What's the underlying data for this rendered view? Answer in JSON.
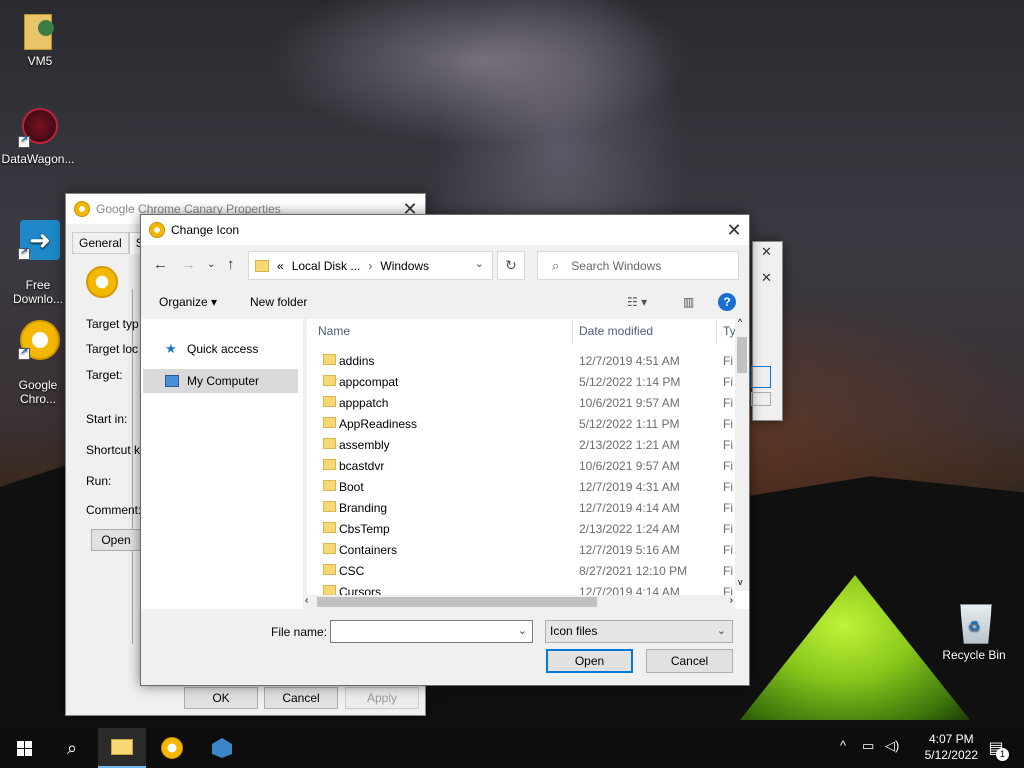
{
  "desktop": {
    "icons": [
      {
        "label": "VM5"
      },
      {
        "label": "DataWagon..."
      },
      {
        "label": "Free\nDownlo..."
      },
      {
        "label": "Google\nChro..."
      },
      {
        "label": "Recycle Bin"
      }
    ]
  },
  "properties_window": {
    "title": "Google Chrome Canary Properties",
    "tabs": [
      "General",
      "Sh"
    ],
    "labels": [
      "Target typ",
      "Target loc",
      "Target:",
      "Start in:",
      "Shortcut k",
      "Run:",
      "Comment:"
    ],
    "open_button": "Open",
    "ok": "OK",
    "cancel": "Cancel",
    "apply": "Apply"
  },
  "dialog": {
    "title": "Change Icon",
    "close_symbol": "✕",
    "address": {
      "overflow": "«",
      "crumbs": [
        "Local Disk ...",
        "Windows"
      ]
    },
    "search_placeholder": "Search Windows",
    "toolbar": {
      "organize": "Organize",
      "new_folder": "New folder",
      "help": "?"
    },
    "nav": {
      "quick_access": "Quick access",
      "my_computer": "My Computer"
    },
    "columns": {
      "name": "Name",
      "date": "Date modified",
      "type": "Ty"
    },
    "files": [
      {
        "name": "addins",
        "date": "12/7/2019 4:51 AM",
        "type": "Fi"
      },
      {
        "name": "appcompat",
        "date": "5/12/2022 1:14 PM",
        "type": "Fi"
      },
      {
        "name": "apppatch",
        "date": "10/6/2021 9:57 AM",
        "type": "Fi"
      },
      {
        "name": "AppReadiness",
        "date": "5/12/2022 1:11 PM",
        "type": "Fi"
      },
      {
        "name": "assembly",
        "date": "2/13/2022 1:21 AM",
        "type": "Fi"
      },
      {
        "name": "bcastdvr",
        "date": "10/6/2021 9:57 AM",
        "type": "Fi"
      },
      {
        "name": "Boot",
        "date": "12/7/2019 4:31 AM",
        "type": "Fi"
      },
      {
        "name": "Branding",
        "date": "12/7/2019 4:14 AM",
        "type": "Fi"
      },
      {
        "name": "CbsTemp",
        "date": "2/13/2022 1:24 AM",
        "type": "Fi"
      },
      {
        "name": "Containers",
        "date": "12/7/2019 5:16 AM",
        "type": "Fi"
      },
      {
        "name": "CSC",
        "date": "8/27/2021 12:10 PM",
        "type": "Fi"
      },
      {
        "name": "Cursors",
        "date": "12/7/2019 4:14 AM",
        "type": "Fi"
      }
    ],
    "file_name_label": "File name:",
    "file_name_value": "",
    "file_type": "Icon files",
    "open": "Open",
    "cancel": "Cancel"
  },
  "taskbar": {
    "time": "4:07 PM",
    "date": "5/12/2022",
    "notification_count": "1"
  }
}
